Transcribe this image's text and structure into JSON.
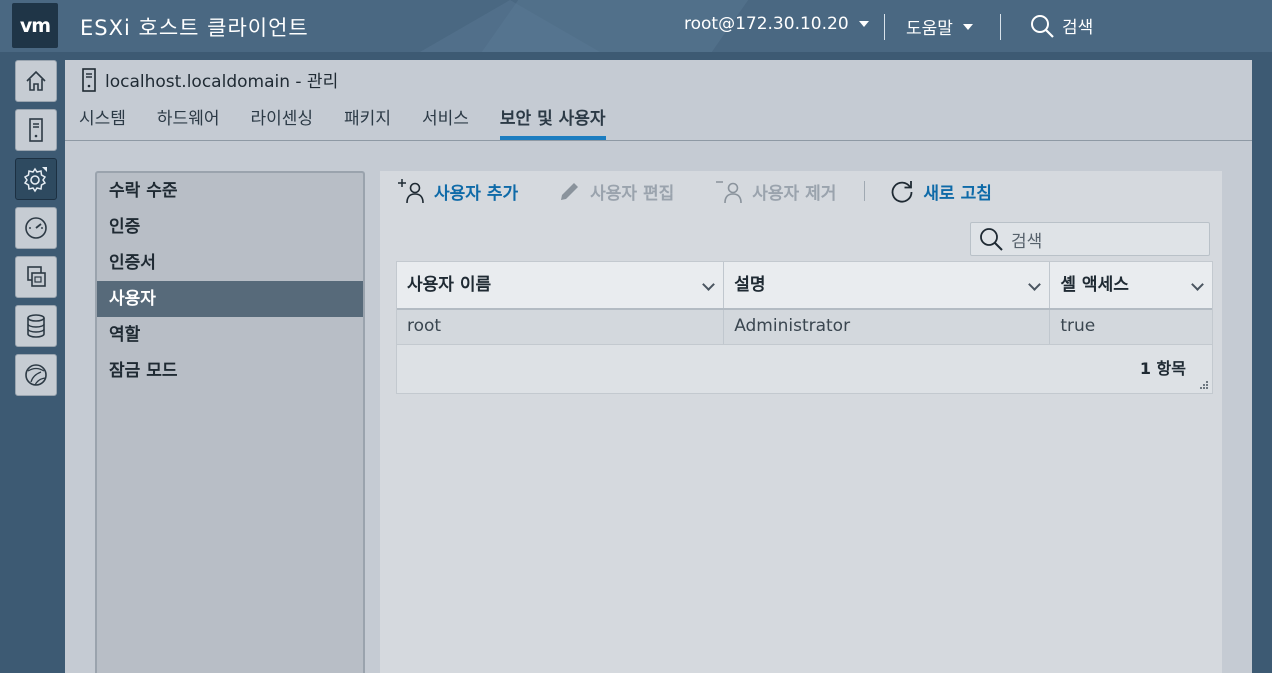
{
  "header": {
    "logo": "vm",
    "app_title": "ESXi 호스트 클라이언트",
    "user": "root@172.30.10.20",
    "help": "도움말",
    "search": "검색"
  },
  "leftnav": {
    "icons": [
      "home-icon",
      "host-icon",
      "manage-gear-icon",
      "monitor-gauge-icon",
      "virtual-machines-icon",
      "storage-icon",
      "networking-icon"
    ],
    "active_index": 2
  },
  "page": {
    "title": "localhost.localdomain - 관리",
    "tabs": [
      "시스템",
      "하드웨어",
      "라이센싱",
      "패키지",
      "서비스",
      "보안 및 사용자"
    ],
    "active_tab": "보안 및 사용자"
  },
  "sublist": {
    "items": [
      "수락 수준",
      "인증",
      "인증서",
      "사용자",
      "역할",
      "잠금 모드"
    ],
    "active": "사용자"
  },
  "toolbar": {
    "add_user": "사용자 추가",
    "edit_user": "사용자 편집",
    "remove_user": "사용자 제거",
    "refresh": "새로 고침"
  },
  "grid": {
    "search_placeholder": "검색",
    "columns": [
      "사용자 이름",
      "설명",
      "셸 액세스"
    ],
    "rows": [
      [
        "root",
        "Administrator",
        "true"
      ]
    ],
    "footer": "1 항목"
  },
  "colors": {
    "header_bg": "#4a6882",
    "accent": "#1c7dc0",
    "selected_item_bg": "#576a7a",
    "link": "#0e6aa8"
  }
}
